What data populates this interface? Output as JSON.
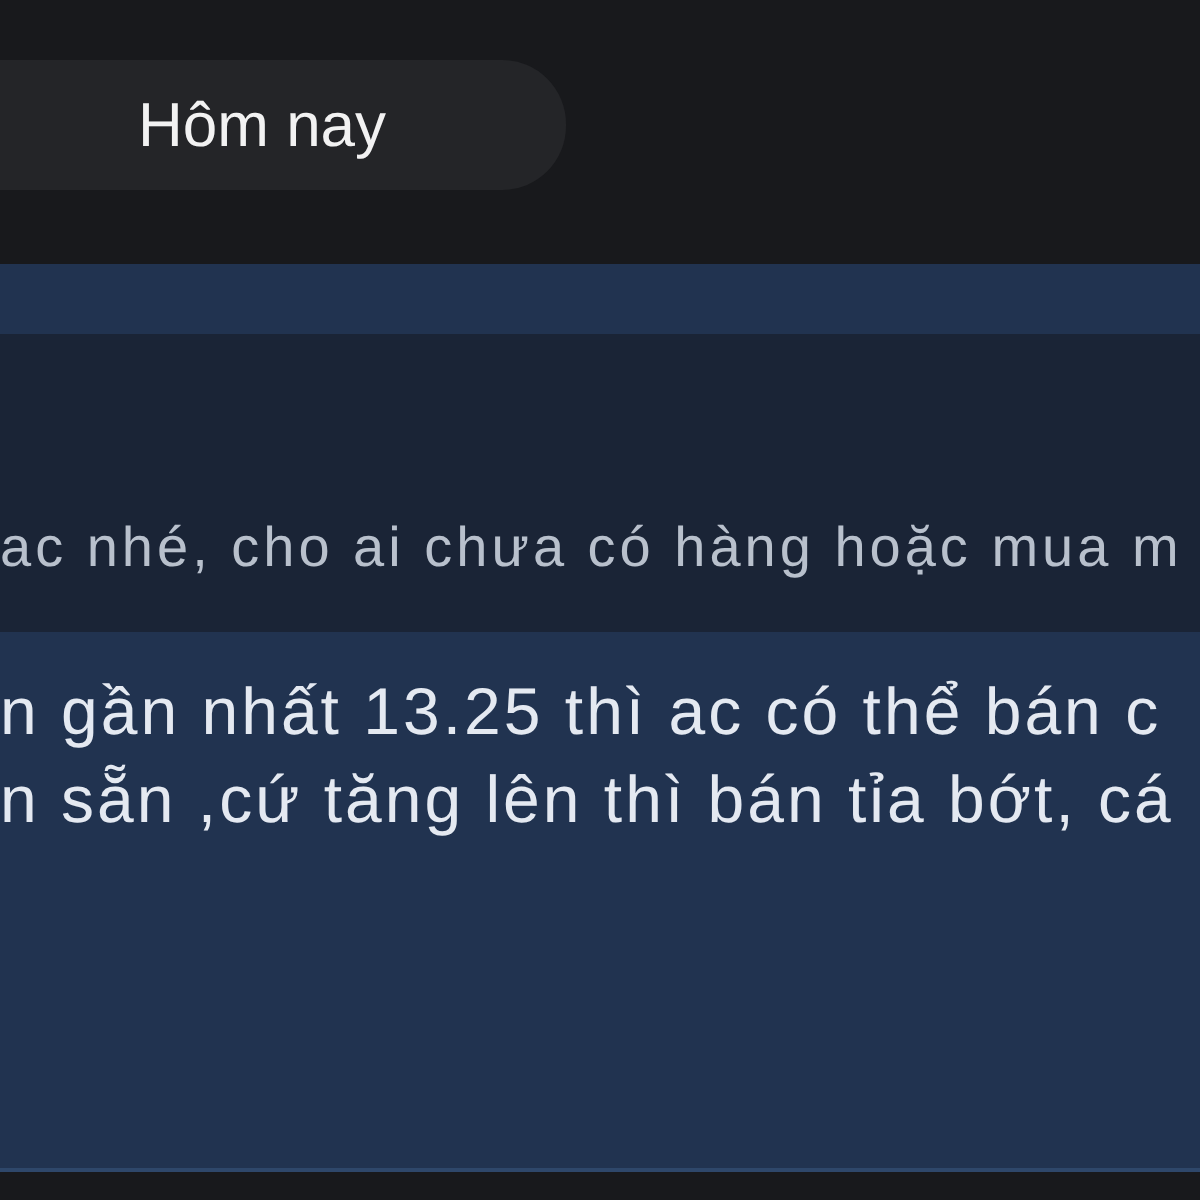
{
  "date_chip": {
    "label": "Hôm nay"
  },
  "message": {
    "quote": {
      "text": "ac nhé, cho ai chưa có hàng hoặc mua m"
    },
    "lines": [
      "n gần nhất 13.25 thì ac có thể bán c",
      "n sẵn ,cứ tăng lên thì bán tỉa bớt, cá"
    ]
  }
}
